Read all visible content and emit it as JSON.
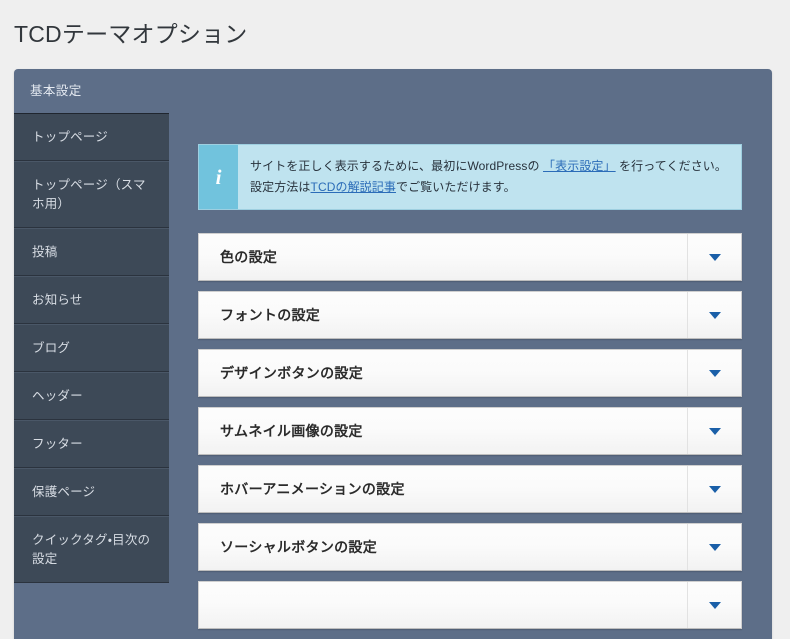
{
  "page": {
    "title": "TCDテーマオプション",
    "background_color": "#efefef"
  },
  "colors": {
    "panel_frame": "#5d6e88",
    "sidebar": "#3d4957",
    "notice_body": "#bfe3ef",
    "notice_icon_bg": "#71c3dd",
    "link": "#2b6cb8",
    "chevron": "#1a5fa8"
  },
  "tabs": [
    {
      "label": "基本設定",
      "active": true
    }
  ],
  "sidebar": {
    "items": [
      {
        "label": "トップページ"
      },
      {
        "label": "トップページ（スマホ用）"
      },
      {
        "label": "投稿"
      },
      {
        "label": "お知らせ"
      },
      {
        "label": "ブログ"
      },
      {
        "label": "ヘッダー"
      },
      {
        "label": "フッター"
      },
      {
        "label": "保護ページ"
      },
      {
        "label": "クイックタグ・目次の設定"
      }
    ]
  },
  "notice": {
    "icon": "info-icon",
    "icon_glyph": "i",
    "text_before_link1": "サイトを正しく表示するために、最初にWordPressの ",
    "link1_label": "「表示設定」",
    "text_between_links": " を行ってください。設定方法は",
    "link2_label": "TCDの解説記事",
    "text_after_link2": "でご覧いただけます。"
  },
  "panels": [
    {
      "title": "色の設定",
      "expanded": false,
      "toggle_icon": "chevron-down-icon"
    },
    {
      "title": "フォントの設定",
      "expanded": false,
      "toggle_icon": "chevron-down-icon"
    },
    {
      "title": "デザインボタンの設定",
      "expanded": false,
      "toggle_icon": "chevron-down-icon"
    },
    {
      "title": "サムネイル画像の設定",
      "expanded": false,
      "toggle_icon": "chevron-down-icon"
    },
    {
      "title": "ホバーアニメーションの設定",
      "expanded": false,
      "toggle_icon": "chevron-down-icon"
    },
    {
      "title": "ソーシャルボタンの設定",
      "expanded": false,
      "toggle_icon": "chevron-down-icon"
    },
    {
      "title": "",
      "expanded": false,
      "toggle_icon": "chevron-down-icon"
    }
  ]
}
